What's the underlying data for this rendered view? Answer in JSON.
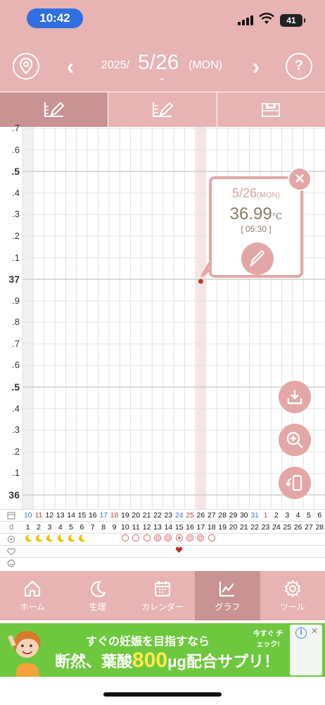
{
  "status_bar": {
    "time": "10:42",
    "battery": "41"
  },
  "header": {
    "year": "2025/",
    "date": "5/26",
    "weekday": "(MON)",
    "prev_label": "‹",
    "next_label": "›",
    "help_label": "?",
    "caret": "⌄"
  },
  "tabs": [
    {
      "name": "graph-temperature",
      "active": true
    },
    {
      "name": "graph-detail",
      "active": false
    },
    {
      "name": "graph-record",
      "active": false
    }
  ],
  "chart": {
    "y_labels": [
      ".7",
      ".6",
      ".5",
      ".4",
      ".3",
      ".2",
      ".1",
      "37",
      ".9",
      ".8",
      ".7",
      ".6",
      ".5",
      ".4",
      ".3",
      ".2",
      ".1",
      "36"
    ],
    "major_labels": [
      ".5",
      "37",
      ".5",
      "36"
    ],
    "y_top": 36.7,
    "y_bottom": 36.0,
    "points": [
      {
        "day": "26",
        "temp": 36.99
      }
    ],
    "selected_day": "26"
  },
  "popup": {
    "date": "5/26",
    "weekday": "(MON)",
    "temp": "36.99",
    "unit": "°C",
    "time": "[ 05:30 ]",
    "close_label": "×"
  },
  "day_table": {
    "dates": [
      "10",
      "11",
      "12",
      "13",
      "14",
      "15",
      "16",
      "17",
      "18",
      "19",
      "20",
      "21",
      "22",
      "23",
      "24",
      "25",
      "26",
      "27",
      "28",
      "29",
      "30",
      "31",
      "1",
      "2",
      "3",
      "4",
      "5",
      "6"
    ],
    "date_colors": [
      "blue",
      "red",
      "",
      "",
      "",
      "",
      "",
      "blue",
      "red",
      "",
      "",
      "",
      "",
      "",
      "blue",
      "red",
      "",
      "",
      "",
      "",
      "",
      "blue",
      "red",
      "",
      "",
      "",
      "",
      ""
    ],
    "cycle_days": [
      "1",
      "2",
      "3",
      "4",
      "5",
      "6",
      "7",
      "8",
      "9",
      "10",
      "11",
      "12",
      "13",
      "14",
      "15",
      "16",
      "17",
      "18",
      "19",
      "20",
      "21",
      "22",
      "23",
      "24",
      "25",
      "26",
      "27",
      "28"
    ],
    "cycle_label": "d",
    "moons_count": 6,
    "heart_day": "15"
  },
  "bottom_nav": [
    {
      "label": "ホーム",
      "icon": "home-icon",
      "active": false
    },
    {
      "label": "生理",
      "icon": "moon-icon",
      "active": false
    },
    {
      "label": "カレンダー",
      "icon": "calendar-icon",
      "active": false
    },
    {
      "label": "グラフ",
      "icon": "chart-icon",
      "active": true
    },
    {
      "label": "ツール",
      "icon": "gear-icon",
      "active": false
    }
  ],
  "ad": {
    "line1": "すぐの妊娠を目指すなら",
    "line2_prefix": "断然、葉酸",
    "line2_big": "800",
    "line2_suffix": "μg配合サプリ！",
    "badge": "今すぐ チェック!",
    "info": "i",
    "close": "✕"
  }
}
